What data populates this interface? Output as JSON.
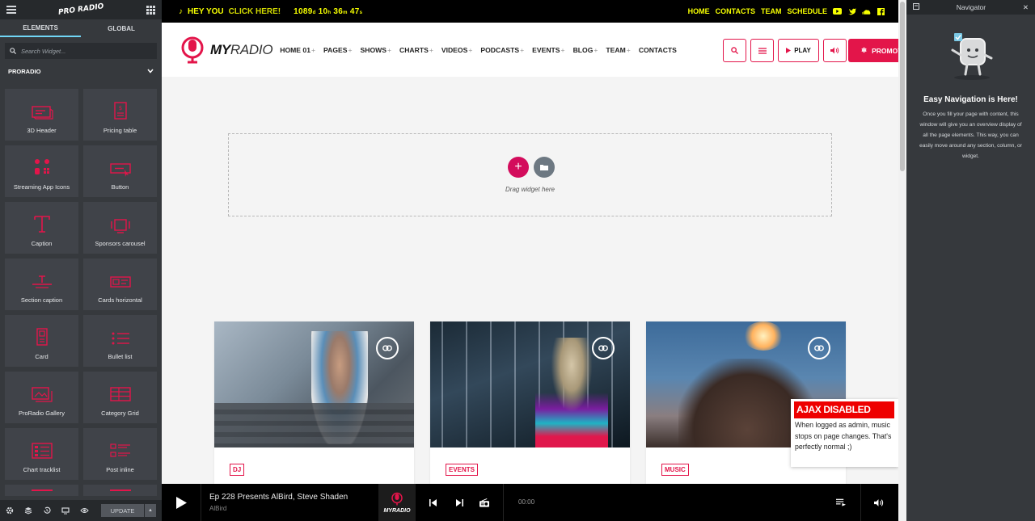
{
  "left_panel": {
    "logo": "PRO RADIO",
    "tabs": [
      "ELEMENTS",
      "GLOBAL"
    ],
    "search_placeholder": "Search Widget...",
    "section": "PRORADIO",
    "widgets": [
      "3D Header",
      "Pricing table",
      "Streaming App Icons",
      "Button",
      "Caption",
      "Sponsors carousel",
      "Section caption",
      "Cards horizontal",
      "Card",
      "Bullet list",
      "ProRadio Gallery",
      "Category Grid",
      "Chart tracklist",
      "Post inline"
    ],
    "update_label": "UPDATE"
  },
  "topbar": {
    "promo_text": "HEY YOU",
    "promo_cta": "CLICK HERE!",
    "countdown": {
      "days": "1089",
      "hours": "10",
      "minutes": "36",
      "seconds": "47"
    },
    "links": [
      "HOME",
      "CONTACTS",
      "TEAM",
      "SCHEDULE"
    ],
    "social_icons": [
      "youtube-icon",
      "twitter-icon",
      "soundcloud-icon",
      "facebook-icon"
    ]
  },
  "header": {
    "brand_bold": "MY",
    "brand_light": "RADIO",
    "nav": [
      "HOME 01",
      "PAGES",
      "SHOWS",
      "CHARTS",
      "VIDEOS",
      "PODCASTS",
      "EVENTS",
      "BLOG",
      "TEAM",
      "CONTACTS"
    ],
    "play_label": "PLAY",
    "promo_label": "PROMOT"
  },
  "canvas": {
    "dropzone_text": "Drag widget here"
  },
  "cards": [
    {
      "tag": "DJ"
    },
    {
      "tag": "EVENTS"
    },
    {
      "tag": "MUSIC"
    }
  ],
  "ajax_notice": {
    "title": "AJAX DISABLED",
    "message": "When logged as admin, music stops on page changes. That's perfectly normal ;)"
  },
  "player": {
    "title": "Ep 228 Presents AlBird, Steve Shaden",
    "artist": "AlBird",
    "logo": "MYRADIO",
    "time": "00:00"
  },
  "navigator": {
    "title": "Navigator",
    "heading": "Easy Navigation is Here!",
    "description": "Once you fill your page with content, this window will give you an overview display of all the page elements. This way, you can easily move around any section, column, or widget."
  },
  "colors": {
    "accent": "#e3154a",
    "topbar_text": "#f6ff00",
    "panel": "#36393d"
  }
}
